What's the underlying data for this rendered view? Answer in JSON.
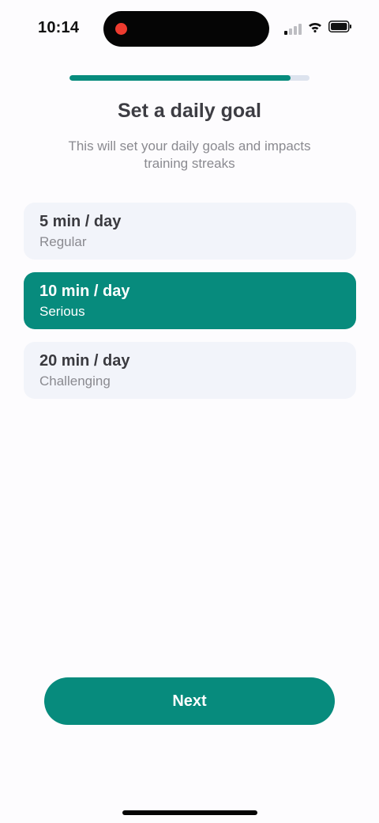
{
  "status_bar": {
    "time": "10:14",
    "icons": [
      "signal-icon",
      "wifi-icon",
      "battery-icon"
    ],
    "recording_color": "#ee3b2f"
  },
  "progress": {
    "fraction": 0.92,
    "color": "#078b7d",
    "track_color": "#dde3ee"
  },
  "header": {
    "title": "Set a daily goal",
    "subtitle": "This will set your daily goals and impacts training streaks"
  },
  "goal_options": [
    {
      "title": "5 min / day",
      "subtitle": "Regular",
      "selected": false
    },
    {
      "title": "10 min / day",
      "subtitle": "Serious",
      "selected": true
    },
    {
      "title": "20 min / day",
      "subtitle": "Challenging",
      "selected": false
    }
  ],
  "footer": {
    "next_label": "Next"
  },
  "colors": {
    "accent": "#078b7d",
    "option_background": "#f2f4fa",
    "page_background": "#fdfcfe"
  }
}
